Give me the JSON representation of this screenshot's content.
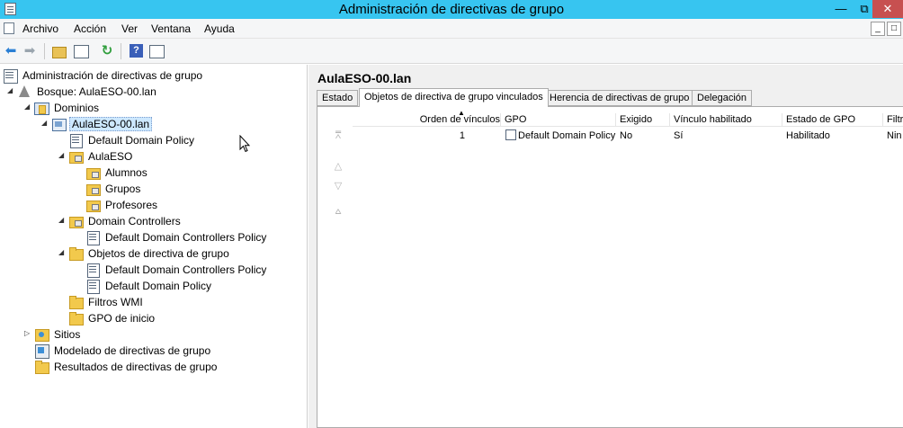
{
  "window": {
    "title": "Administración de directivas de grupo",
    "minimize": "—",
    "maximize": "⧉",
    "close": "✕"
  },
  "menu": {
    "items": [
      "Archivo",
      "Acción",
      "Ver",
      "Ventana",
      "Ayuda"
    ],
    "mdi_minimize": "_",
    "mdi_restore": "□"
  },
  "toolbar": {
    "back": "⬅",
    "forward": "➡",
    "refresh": "↻"
  },
  "tree": {
    "root": "Administración de directivas de grupo",
    "forest": "Bosque: AulaESO-00.lan",
    "domains": "Dominios",
    "domain": "AulaESO-00.lan",
    "default_domain_policy": "Default Domain Policy",
    "ou_aulaeso": "AulaESO",
    "ou_alumnos": "Alumnos",
    "ou_grupos": "Grupos",
    "ou_profesores": "Profesores",
    "ou_dcs": "Domain Controllers",
    "dc_policy_link": "Default Domain Controllers Policy",
    "gpo_container": "Objetos de directiva de grupo",
    "gpo_dc_policy": "Default Domain Controllers Policy",
    "gpo_domain_policy": "Default Domain Policy",
    "wmi_filters": "Filtros WMI",
    "starter_gpos": "GPO de inicio",
    "sites": "Sitios",
    "modeling": "Modelado de directivas de grupo",
    "results": "Resultados de directivas de grupo",
    "expanded_glyph": "◢",
    "collapsed_glyph": "▷"
  },
  "detail": {
    "title": "AulaESO-00.lan",
    "tabs": {
      "estado": "Estado",
      "vinculados": "Objetos de directiva de grupo vinculados",
      "herencia": "Herencia de directivas de grupo",
      "delegacion": "Delegación"
    },
    "move_buttons": {
      "top": "⩞",
      "up": "△",
      "down": "▽",
      "bottom": "⩟"
    },
    "table": {
      "columns": {
        "orden": "Orden de vínculos",
        "gpo": "GPO",
        "exigido": "Exigido",
        "vinculo": "Vínculo habilitado",
        "estado": "Estado de GPO",
        "filtro": "Filtr"
      },
      "sort_indicator": "▲",
      "rows": [
        {
          "orden": "1",
          "gpo": "Default Domain Policy",
          "exigido": "No",
          "vinculo": "Sí",
          "estado": "Habilitado",
          "filtro": "Nin"
        }
      ]
    }
  }
}
